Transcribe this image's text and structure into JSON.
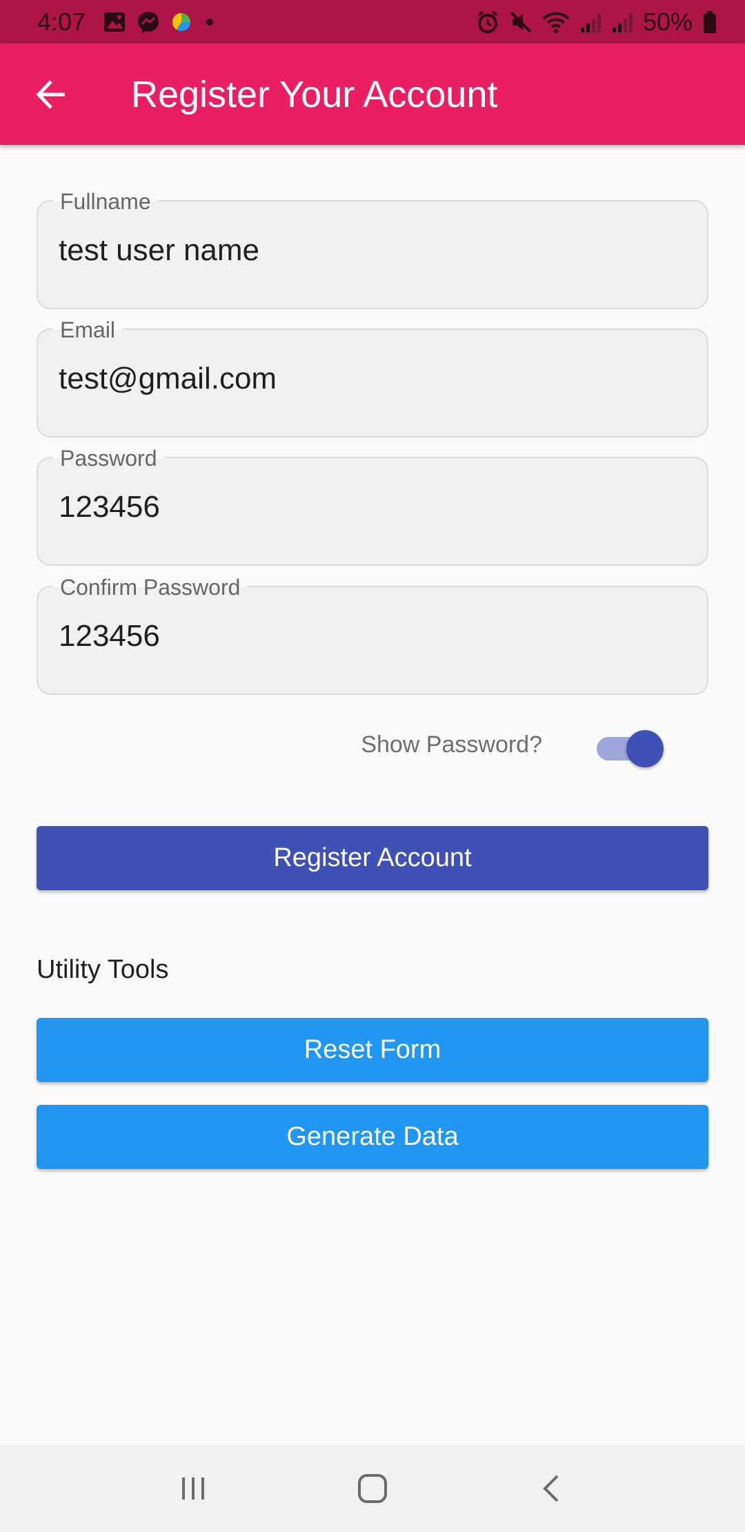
{
  "status_bar": {
    "time": "4:07",
    "battery": "50%",
    "left_icons": [
      "gallery-icon",
      "messenger-icon",
      "pie-icon",
      "dot-icon"
    ],
    "right_icons": [
      "alarm-icon",
      "mute-icon",
      "wifi-icon",
      "signal-icon",
      "signal-icon",
      "battery-icon"
    ]
  },
  "app_bar": {
    "title": "Register Your Account",
    "back_icon": "arrow-back-icon",
    "color": "#e91e63"
  },
  "form": {
    "fullname": {
      "label": "Fullname",
      "value": "test user name"
    },
    "email": {
      "label": "Email",
      "value": "test@gmail.com"
    },
    "password": {
      "label": "Password",
      "value": "123456"
    },
    "confirm_password": {
      "label": "Confirm Password",
      "value": "123456"
    },
    "show_password": {
      "label": "Show Password?",
      "on": true
    }
  },
  "buttons": {
    "register": "Register Account",
    "reset": "Reset Form",
    "generate": "Generate Data"
  },
  "utility": {
    "title": "Utility Tools"
  },
  "colors": {
    "status_bar": "#ad1547",
    "primary": "#3f51b5",
    "secondary": "#2196f3"
  },
  "nav_bar": {
    "icons": [
      "recents-icon",
      "home-icon",
      "back-icon"
    ]
  }
}
